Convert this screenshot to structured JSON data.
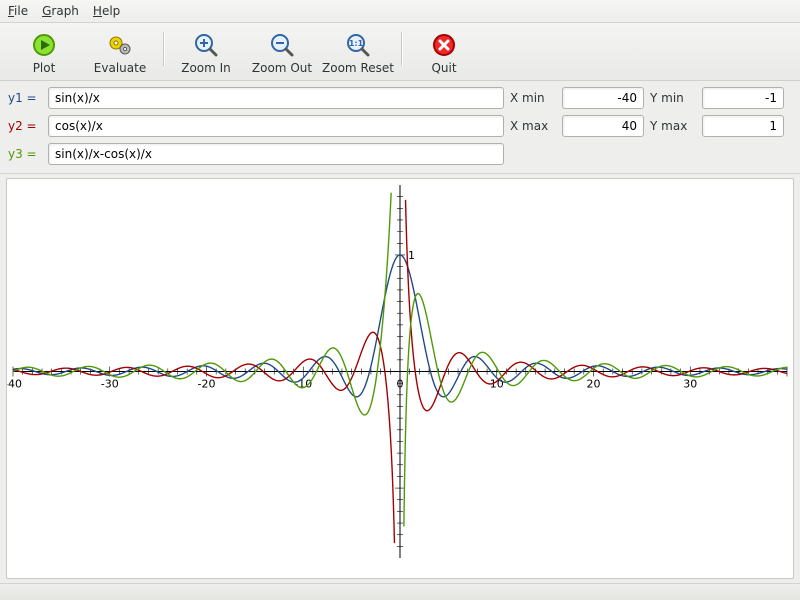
{
  "menu": {
    "file": "File",
    "graph": "Graph",
    "help": "Help"
  },
  "toolbar": {
    "plot": "Plot",
    "evaluate": "Evaluate",
    "zoom_in": "Zoom In",
    "zoom_out": "Zoom Out",
    "zoom_reset": "Zoom Reset",
    "quit": "Quit"
  },
  "equations": {
    "y1_label": "y1 =",
    "y1_value": "sin(x)/x",
    "y2_label": "y2 =",
    "y2_value": "cos(x)/x",
    "y3_label": "y3 =",
    "y3_value": "sin(x)/x-cos(x)/x"
  },
  "limits": {
    "xmin_label": "X min",
    "xmin_value": "-40",
    "xmax_label": "X max",
    "xmax_value": "40",
    "ymin_label": "Y min",
    "ymin_value": "-1",
    "ymax_label": "Y max",
    "ymax_value": "1"
  },
  "chart_data": {
    "type": "line",
    "xlim": [
      -40,
      40
    ],
    "ylim": [
      -1,
      1
    ],
    "x_ticks": [
      -40,
      -30,
      -20,
      -10,
      0,
      10,
      20,
      30
    ],
    "y_ticks": [
      1
    ],
    "series": [
      {
        "name": "y1",
        "expr": "sin(x)/x",
        "color": "#204a87"
      },
      {
        "name": "y2",
        "expr": "cos(x)/x",
        "color": "#a40000"
      },
      {
        "name": "y3",
        "expr": "sin(x)/x-cos(x)/x",
        "color": "#4e9a06"
      }
    ]
  }
}
